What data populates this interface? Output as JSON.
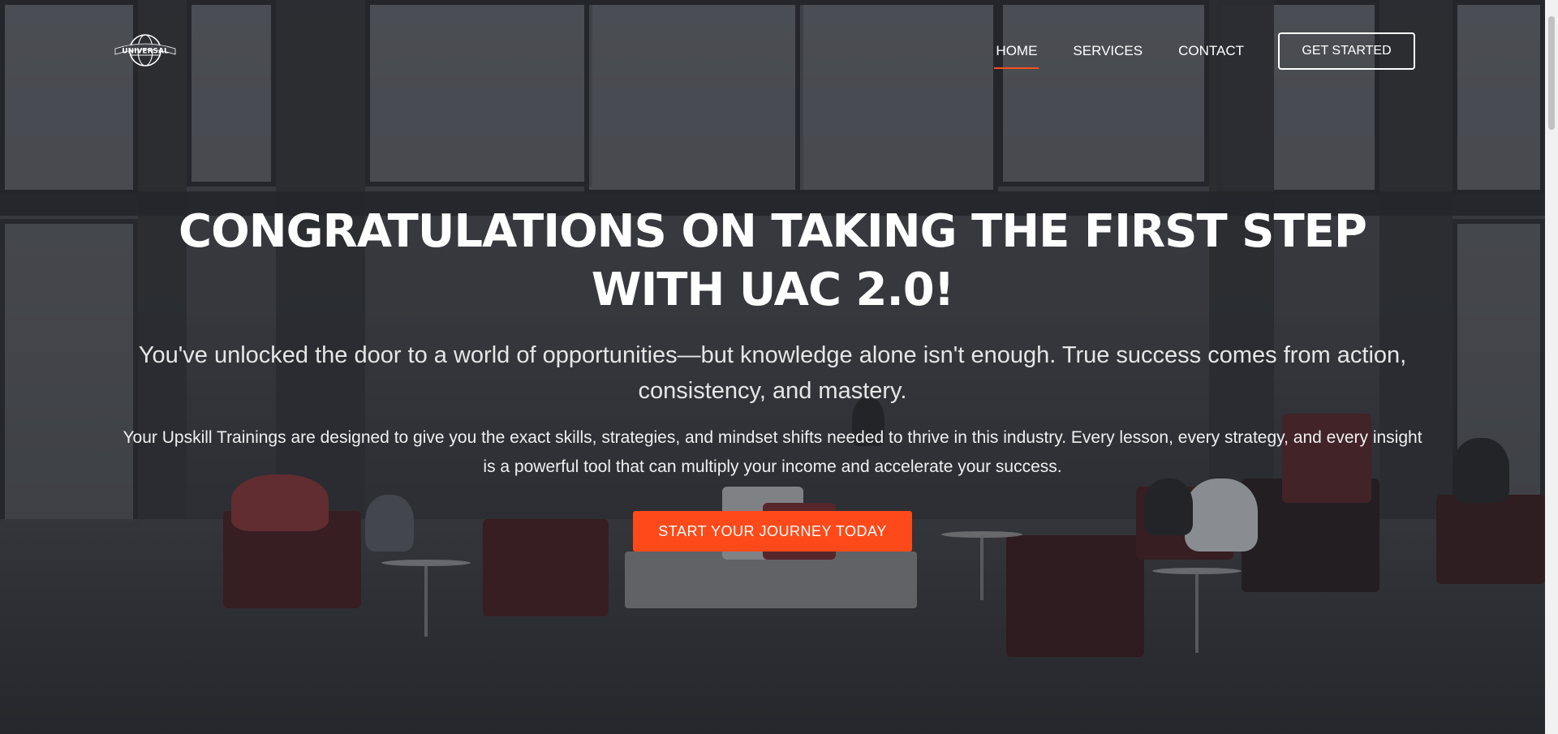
{
  "brand": {
    "logo_text": "UNIVERSAL"
  },
  "nav": {
    "items": [
      {
        "label": "HOME",
        "active": true
      },
      {
        "label": "SERVICES",
        "active": false
      },
      {
        "label": "CONTACT",
        "active": false
      }
    ],
    "cta_label": "GET STARTED"
  },
  "hero": {
    "headline": "CONGRATULATIONS ON TAKING THE FIRST STEP WITH UAC 2.0!",
    "lead": "You've unlocked the door to a world of opportunities—but knowledge alone isn't enough. True success comes from action, consistency, and mastery.",
    "body": "Your Upskill Trainings are designed to give you the exact skills, strategies, and mindset shifts needed to thrive in this industry. Every lesson, every strategy, and every insight is a powerful tool that can multiply your income and accelerate your success.",
    "cta_label": "START YOUR JOURNEY TODAY"
  },
  "colors": {
    "accent": "#fe4a1a",
    "text": "#ffffff"
  }
}
